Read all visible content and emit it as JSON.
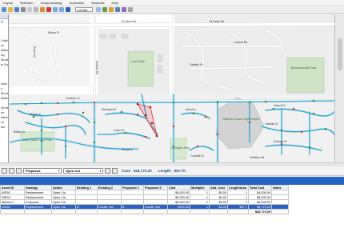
{
  "menu": [
    "Layout",
    "Selection",
    "Geoprocessing",
    "Customize",
    "Windows",
    "Help"
  ],
  "toolbar": {
    "scale": "1:6,000"
  },
  "left_panel": {
    "items": [
      "ty",
      "",
      "",
      "",
      "Collection",
      "on",
      "Station",
      "ary",
      "Structure",
      "er Suppo",
      "",
      "",
      "",
      "lined",
      "s",
      "Structure",
      "Stations",
      "",
      "Structure",
      "en",
      "Valves",
      "es",
      "ant"
    ]
  },
  "map": {
    "streets": [
      "W Genn Rd",
      "Rubus Ct",
      "Rubus Pl",
      "W Davis Rd",
      "Sullivan Rd",
      "Cornhus Ln",
      "Dicker Dr",
      "Eldorado Dr",
      "Coker Dr",
      "Bilbao Dr",
      "Oxford Dr",
      "Atlantic Dr",
      "Ashlund Dr",
      "Mead Ln",
      "Fairfield Dr",
      "Lucinda Rd",
      "Scope Dr",
      "Holliston Rd",
      "Coxfield Dr"
    ],
    "parks": [
      "Lions Park",
      "Brownsmeade Park",
      "Cape Gable Cove Park",
      "Jefferson Junior High School",
      "Carrigton Park"
    ]
  },
  "edit_toolbar": {
    "status": "Proposed",
    "action": "Open Cut",
    "cost_label": "Cost:",
    "cost_value": "$46,770.20",
    "length_label": "Length:",
    "length_value": "$57.70"
  },
  "table": {
    "columns": [
      "Asset ID",
      "Strategy",
      "Action",
      "Existing 1",
      "Existing 2",
      "Proposed 1",
      "Proposed 2",
      "Cost",
      "Multiplier",
      "Add. Cost",
      "Length/Area",
      "Total Cost",
      "Notes"
    ],
    "rows": [
      [
        "40530",
        "Replacement",
        "Open Cut",
        "",
        "",
        "",
        "",
        "$4,000.00",
        "1",
        "$0.00",
        "1",
        "$4,000.00",
        ""
      ],
      [
        "29803",
        "Replacement",
        "Open Cut",
        "",
        "",
        "",
        "",
        "$4,000.00",
        "1",
        "$0.00",
        "1",
        "$4,000.00",
        ""
      ],
      [
        "Sketch-1",
        "Proposed",
        "Open Cut",
        "",
        "",
        "",
        "",
        "$4,000.00",
        "1",
        "$0.00",
        "1",
        "$4,000.00",
        ""
      ],
      [
        "12830",
        "Replacement",
        "Open Cut",
        "8\"",
        "Ductile Iron",
        "8\"",
        "Ductile Iron",
        "$100.00",
        "1",
        "$0.00",
        "$57.7",
        "$5,770.00",
        ""
      ]
    ],
    "selected_row": 3,
    "total": [
      "",
      "",
      "",
      "",
      "",
      "",
      "",
      "",
      "",
      "",
      "",
      "$46,770.20",
      ""
    ]
  },
  "colors": {
    "pipe": "#1ea7d8",
    "selection": "#e23b3b",
    "row_highlight": "#2b5fc4",
    "bluestrip": "#2563c4"
  }
}
